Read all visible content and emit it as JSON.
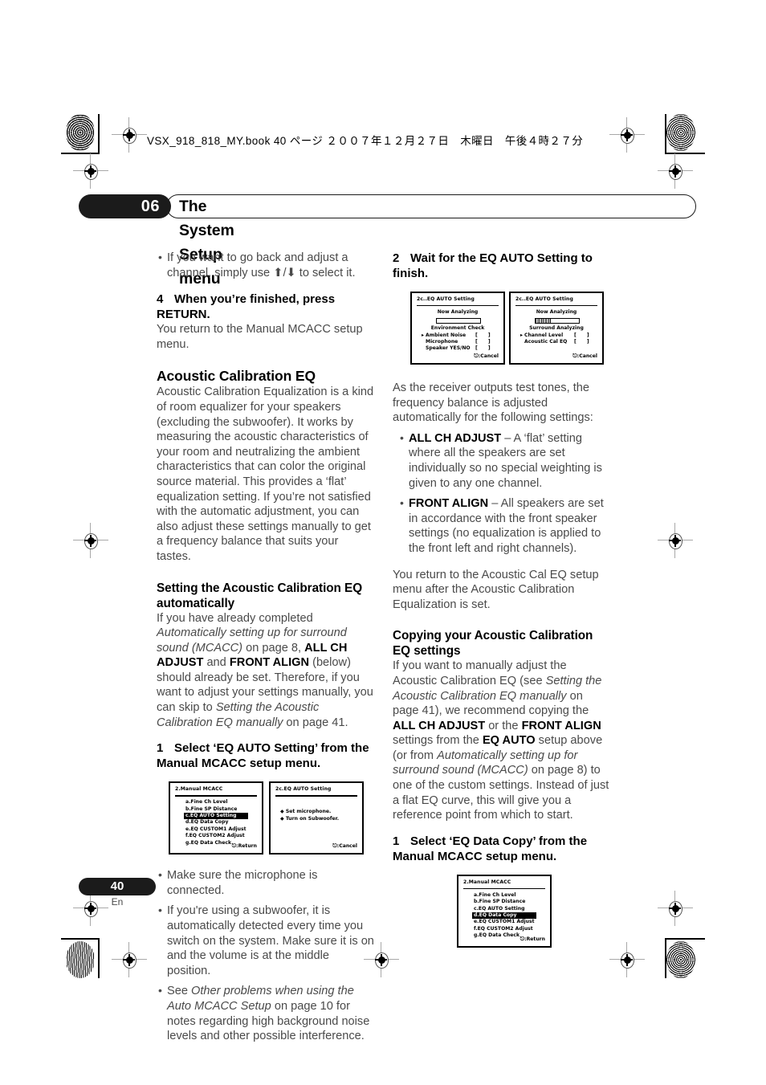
{
  "print_marks": {
    "running_head": "VSX_918_818_MY.book 40 ページ ２００７年１２月２７日　木曜日　午後４時２７分"
  },
  "chapter": {
    "number": "06",
    "title": "The System Setup menu"
  },
  "left_column": {
    "intro_bullet": "If you want to go back and adjust a channel, simply use ⬆/⬇ to select it.",
    "step4_num": "4",
    "step4_title": "When you’re finished, press RETURN.",
    "step4_body": "You return to the Manual MCACC setup menu.",
    "heading": "Acoustic Calibration EQ",
    "heading_body": "Acoustic Calibration Equalization is a kind of room equalizer for your speakers (excluding the subwoofer). It works by measuring the acoustic characteristics of your room and neutralizing the ambient characteristics that can color the original source material. This provides a ‘flat’ equalization setting. If you’re not satisfied with the automatic adjustment, you can also adjust these settings manually to get a frequency balance that suits your tastes.",
    "subheading": "Setting the Acoustic Calibration EQ automatically",
    "sub_body_1": "If you have already completed ",
    "sub_body_italic_1": "Automatically setting up for surround sound (MCACC)",
    "sub_body_2": " on page 8, ",
    "sub_body_bold_1": "ALL CH ADJUST",
    "sub_body_3": " and ",
    "sub_body_bold_2": "FRONT ALIGN",
    "sub_body_4": " (below) should already be set. Therefore, if you want to adjust your settings manually, you can skip to ",
    "sub_body_italic_2": "Setting the Acoustic Calibration EQ manually",
    "sub_body_5": " on page 41.",
    "step1_num": "1",
    "step1_title": "Select ‘EQ AUTO Setting’ from the Manual MCACC setup menu.",
    "bullets": [
      "Make sure the microphone is connected.",
      "If you're using a subwoofer, it is automatically detected every time you switch on the system. Make sure it is on and the volume is at the middle position."
    ],
    "bullet3_lead": "See ",
    "bullet3_italic": "Other problems when using the Auto MCACC Setup",
    "bullet3_rest": " on page 10 for notes regarding high background noise levels and other possible interference."
  },
  "right_column": {
    "step2_num": "2",
    "step2_title": "Wait for the EQ AUTO Setting to finish.",
    "body_1": "As the receiver outputs test tones, the frequency balance is adjusted automatically for the following settings:",
    "bullet_1_bold": "ALL CH ADJUST",
    "bullet_1_rest": " – A ‘flat’ setting where all the speakers are set individually so no special weighting is given to any one channel.",
    "bullet_2_bold": "FRONT ALIGN",
    "bullet_2_rest": " – All speakers are set in accordance with the front speaker settings (no equalization is applied to the front left and right channels).",
    "body_2": "You return to the Acoustic Cal EQ setup menu after the Acoustic Calibration Equalization is set.",
    "subheading": "Copying your Acoustic Calibration EQ settings",
    "copy_1": "If you want to manually adjust the Acoustic Calibration EQ (see ",
    "copy_italic_1": "Setting the Acoustic Calibration EQ manually",
    "copy_2": " on page 41), we recommend copying the ",
    "copy_bold_1": "ALL CH ADJUST",
    "copy_3": " or the ",
    "copy_bold_2": "FRONT ALIGN",
    "copy_4": " settings from the ",
    "copy_bold_3": "EQ AUTO",
    "copy_5": " setup above (or from ",
    "copy_italic_2": "Automatically setting up for surround sound (MCACC)",
    "copy_6": " on page 8) to one of the custom settings. Instead of just a flat EQ curve, this will give you a reference point from which to start.",
    "step1_num": "1",
    "step1_title": "Select ‘EQ Data Copy’ from the Manual MCACC setup menu."
  },
  "osd": {
    "manual_mcacc_eqauto": {
      "title": "2.Manual  MCACC",
      "items": [
        "a.Fine  Ch  Level",
        "b.Fine  SP  Distance",
        "c.EQ  AUTO  Setting",
        "d.EQ  Data  Copy",
        "e.EQ  CUSTOM1  Adjust",
        "f.EQ  CUSTOM2  Adjust",
        "g.EQ  Data  Check"
      ],
      "selected_index": 2,
      "footer": ":Return"
    },
    "eq_auto_setting_prompt": {
      "title": "2c.EQ  AUTO  Setting",
      "items": [
        "Set  microphone.",
        "Turn  on  Subwoofer."
      ],
      "footer": ":Cancel"
    },
    "analyzing_1": {
      "title": "2c..EQ  AUTO  Setting",
      "status": "Now  Analyzing",
      "progress_percent": 0,
      "phase": "Environment  Check",
      "items": [
        {
          "marker": "▸",
          "name": "Ambient  Noise",
          "value": "[      ]"
        },
        {
          "marker": "",
          "name": "Microphone",
          "value": "[      ]"
        },
        {
          "marker": "",
          "name": "Speaker  YES/NO",
          "value": "[      ]"
        }
      ],
      "footer": ":Cancel"
    },
    "analyzing_2": {
      "title": "2c..EQ  AUTO  Setting",
      "status": "Now  Analyzing",
      "progress_percent": 35,
      "phase": "Surround  Analyzing",
      "items": [
        {
          "marker": "▸",
          "name": "Channel  Level",
          "value": "[      ]"
        },
        {
          "marker": "",
          "name": "Acoustic  Cal  EQ",
          "value": "[      ]"
        }
      ],
      "footer": ":Cancel"
    },
    "manual_mcacc_datacopy": {
      "title": "2.Manual  MCACC",
      "items": [
        "a.Fine  Ch  Level",
        "b.Fine  SP  Distance",
        "c.EQ  AUTO  Setting",
        "d.EQ  Data  Copy",
        "e.EQ  CUSTOM1  Adjust",
        "f.EQ  CUSTOM2  Adjust",
        "g.EQ  Data  Check"
      ],
      "selected_index": 3,
      "footer": ":Return"
    }
  },
  "folio": {
    "page_number": "40",
    "language": "En"
  }
}
